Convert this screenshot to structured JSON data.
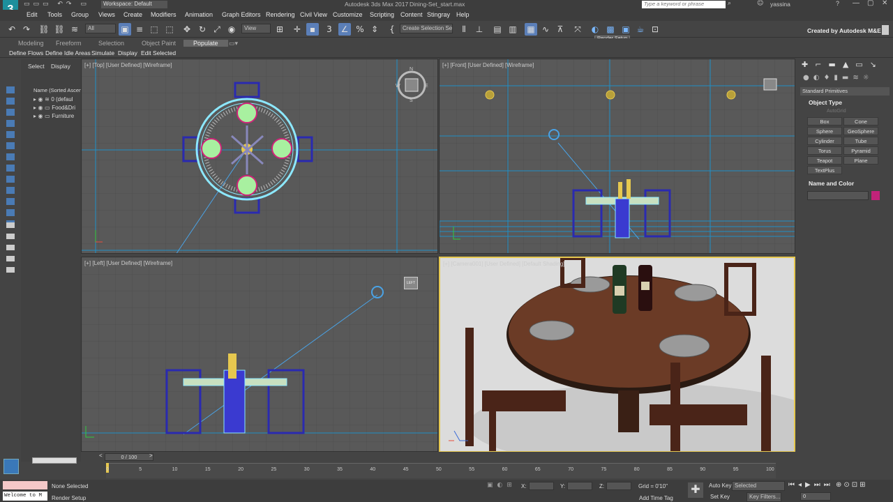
{
  "titlebar": {
    "workspace": "Workspace: Default",
    "app_title": "Autodesk 3ds Max 2017",
    "file_name": "Dining-Set_start.max",
    "search_placeholder": "Type a keyword or phrase",
    "user": "yassina"
  },
  "menus": [
    "Edit",
    "Tools",
    "Group",
    "Views",
    "Create",
    "Modifiers",
    "Animation",
    "Graph Editors",
    "Rendering",
    "Civil View",
    "Customize",
    "Scripting",
    "Content",
    "Stingray",
    "Help"
  ],
  "toolbar": {
    "filter": "All",
    "view": "View",
    "selection_set": "Create Selection Se",
    "tooltip": "Render Setup",
    "created_by": "Created by Autodesk M&E"
  },
  "ribbon": {
    "tabs": [
      "Modeling",
      "Freeform",
      "Selection",
      "Object Paint",
      "Populate"
    ],
    "subtabs": [
      "Define Flows",
      "Define Idle Areas",
      "Simulate",
      "Display",
      "Edit Selected"
    ]
  },
  "explorer": {
    "tabs": [
      "Select",
      "Display"
    ],
    "header": "Name (Sorted Ascen",
    "rows": [
      "0 (defaul",
      "Food&Dri",
      "Furniture"
    ]
  },
  "viewports": {
    "top": "[+] [Top] [User Defined] [Wireframe]",
    "front": "[+] [Front] [User Defined] [Wireframe]",
    "left": "[+] [Left] [User Defined] [Wireframe]",
    "camera": "[+] [Camera001] [User Defined] [Default Shading]",
    "left_cube": "LEFT"
  },
  "cmdpanel": {
    "category": "Standard Primitives",
    "object_type": "Object Type",
    "autogrid": "AutoGrid",
    "primitives": [
      "Box",
      "Cone",
      "Sphere",
      "GeoSphere",
      "Cylinder",
      "Tube",
      "Torus",
      "Pyramid",
      "Teapot",
      "Plane",
      "TextPlus"
    ],
    "name_color": "Name and Color",
    "swatch_color": "#c2237a"
  },
  "timeline": {
    "frame": "0 / 100",
    "ticks": [
      "0",
      "5",
      "10",
      "15",
      "20",
      "25",
      "30",
      "35",
      "40",
      "45",
      "50",
      "55",
      "60",
      "65",
      "70",
      "75",
      "80",
      "85",
      "90",
      "95",
      "100"
    ]
  },
  "status": {
    "welcome": "Welcome to M",
    "none_selected": "None Selected",
    "render_setup": "Render Setup",
    "x_label": "X:",
    "y_label": "Y:",
    "z_label": "Z:",
    "grid": "Grid = 0'10\"",
    "add_time_tag": "Add Time Tag",
    "auto_key": "Auto Key",
    "key_mode": "Selected",
    "set_key": "Set Key",
    "key_filters": "Key Filters...",
    "current_frame": "0"
  }
}
